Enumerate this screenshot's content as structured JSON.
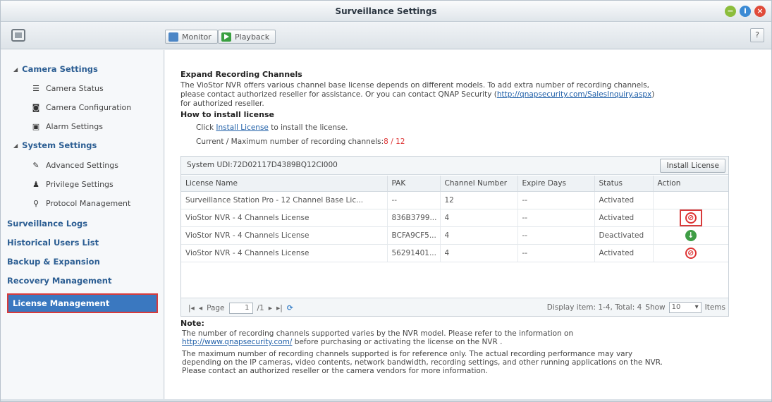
{
  "window": {
    "title": "Surveillance Settings",
    "controls": {
      "minimize": "−",
      "help": "i",
      "close": "×"
    }
  },
  "toolbar": {
    "monitor_label": "Monitor",
    "playback_label": "Playback",
    "help_label": "?"
  },
  "sidebar": {
    "camera_settings": "Camera Settings",
    "camera_items": [
      {
        "label": "Camera Status",
        "icon": "list-icon"
      },
      {
        "label": "Camera Configuration",
        "icon": "camera-icon"
      },
      {
        "label": "Alarm Settings",
        "icon": "alarm-icon"
      }
    ],
    "system_settings": "System Settings",
    "system_items": [
      {
        "label": "Advanced Settings",
        "icon": "wrench-icon"
      },
      {
        "label": "Privilege Settings",
        "icon": "user-icon"
      },
      {
        "label": "Protocol Management",
        "icon": "network-icon"
      }
    ],
    "surveillance_logs": "Surveillance Logs",
    "historical_users": "Historical Users List",
    "backup_expansion": "Backup & Expansion",
    "recovery_management": "Recovery Management",
    "license_management": "License Management"
  },
  "content": {
    "heading": "Expand Recording Channels",
    "intro_line1": "The VioStor NVR offers various channel base license depends on different models. To add extra number of recording channels,",
    "intro_line2_prefix": "please contact authorized reseller for assistance. Or you can contact QNAP Security (",
    "intro_link": "http://qnapsecurity.com/SalesInquiry.aspx",
    "intro_line2_suffix": ")",
    "intro_line3": "for authorized reseller.",
    "howto_heading": "How to install license",
    "click_prefix": "Click ",
    "click_link": "Install License",
    "click_suffix": " to install the license.",
    "current_label": "Current / Maximum number of recording channels:",
    "current_value": "8",
    "current_sep": " / ",
    "max_value": "12",
    "system_udi": "System UDI:72D02117D4389BQ12CI000",
    "install_button": "Install License",
    "columns": [
      "License Name",
      "PAK",
      "Channel Number",
      "Expire Days",
      "Status",
      "Action"
    ],
    "rows": [
      {
        "name": "Surveillance Station Pro - 12 Channel Base Lic...",
        "pak": "--",
        "channels": "12",
        "expire": "--",
        "status": "Activated",
        "action": ""
      },
      {
        "name": "VioStor NVR - 4 Channels License",
        "pak": "836B3799...",
        "channels": "4",
        "expire": "--",
        "status": "Activated",
        "action": "deactivate"
      },
      {
        "name": "VioStor NVR - 4 Channels License",
        "pak": "BCFA9CF5...",
        "channels": "4",
        "expire": "--",
        "status": "Deactivated",
        "action": "activate"
      },
      {
        "name": "VioStor NVR - 4 Channels License",
        "pak": "56291401...",
        "channels": "4",
        "expire": "--",
        "status": "Activated",
        "action": "deactivate"
      }
    ],
    "pager": {
      "page_label": "Page",
      "page_value": "1",
      "page_total": "/1",
      "display": "Display item: 1-4, Total: 4",
      "show_label": "Show",
      "show_value": "10",
      "items_label": "Items"
    },
    "note_heading": "Note:",
    "note1_line1": "The number of recording channels supported varies by the NVR model. Please refer to the information on",
    "note1_link": "http://www.qnapsecurity.com/",
    "note1_line2": " before purchasing or activating the license on the NVR .",
    "note2_line1": "The maximum number of recording channels supported is for reference only. The actual recording performance may vary",
    "note2_line2": "depending on the IP cameras, video contents, network bandwidth, recording settings, and other running applications on the NVR.",
    "note2_line3": "Please contact an authorized reseller or the camera vendors for more information."
  }
}
